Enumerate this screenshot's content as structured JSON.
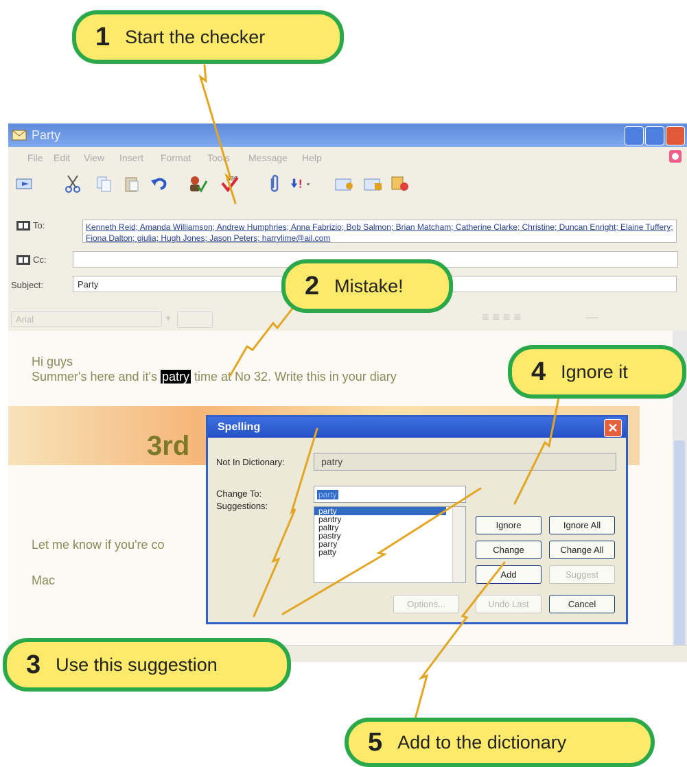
{
  "callouts": {
    "c1": {
      "num": "1",
      "text": "Start the checker"
    },
    "c2": {
      "num": "2",
      "text": "Mistake!"
    },
    "c3": {
      "num": "3",
      "text": "Use this suggestion"
    },
    "c4": {
      "num": "4",
      "text": "Ignore it"
    },
    "c5": {
      "num": "5",
      "text": "Add to the dictionary"
    }
  },
  "window": {
    "title": "Party"
  },
  "menu": [
    "File",
    "Edit",
    "View",
    "Insert",
    "Format",
    "Tools",
    "Message",
    "Help"
  ],
  "fields": {
    "to_label": "To:",
    "to_value": "Kenneth Reid; Amanda Williamson; Andrew Humphries; Anna Fabrizio; Bob Salmon; Brian Matcham; Catherine Clarke; Christine; Duncan Enright; Elaine Tuffery; Fiona Dalton; giulia; Hugh Jones; Jason Peters; harrylime@ail.com",
    "cc_label": "Cc:",
    "subject_label": "Subject:",
    "subject_value": "Party"
  },
  "formatting": {
    "font": "Arial"
  },
  "message": {
    "greeting": "Hi guys",
    "line1_before": "Summer's here and it's",
    "line1_highlight": "patry",
    "line1_after": "time at No 32. Write this in your diary",
    "heading": "3rd",
    "line2": "Let me know if you're co",
    "signature": "Mac"
  },
  "spelling": {
    "title": "Spelling",
    "not_in_dict_label": "Not In Dictionary:",
    "not_in_dict_value": "patry",
    "change_to_label": "Change To:",
    "change_to_value": "party",
    "suggestions_label": "Suggestions:",
    "suggestions": [
      "party",
      "pantry",
      "paltry",
      "pastry",
      "parry",
      "patty"
    ],
    "buttons": {
      "ignore": "Ignore",
      "ignore_all": "Ignore All",
      "change": "Change",
      "change_all": "Change All",
      "add": "Add",
      "suggest": "Suggest",
      "options": "Options...",
      "undo_last": "Undo Last",
      "cancel": "Cancel"
    }
  },
  "colors": {
    "callout_fill": "#fde96a",
    "callout_border": "#2aa84a",
    "arrow": "#e2a623",
    "title_bar": "#3c6fe0"
  }
}
